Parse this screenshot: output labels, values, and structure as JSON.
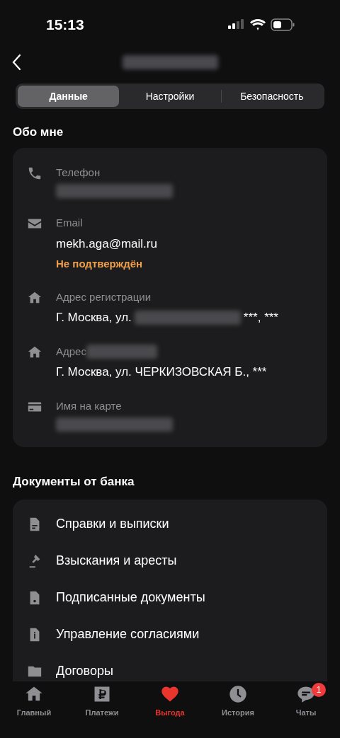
{
  "status_bar": {
    "time": "15:13"
  },
  "header": {
    "title_blurred": true
  },
  "tabs": [
    {
      "label": "Данные",
      "selected": true
    },
    {
      "label": "Настройки",
      "selected": false
    },
    {
      "label": "Безопасность",
      "selected": false
    }
  ],
  "about": {
    "title": "Обо мне",
    "items": [
      {
        "label": "Телефон",
        "value_blurred": true
      },
      {
        "label": "Email",
        "value": "mekh.aga@mail.ru",
        "note": "Не подтверждён"
      },
      {
        "label": "Адрес регистрации",
        "value": "Г. Москва, ул.",
        "value_blurred": true,
        "value_end": "***, ***"
      },
      {
        "label": "Адрес",
        "label_blurred": true,
        "value": "Г. Москва, ул. ЧЕРКИЗОВСКАЯ Б., ***"
      },
      {
        "label": "Имя на карте",
        "value_blurred": true
      }
    ]
  },
  "documents": {
    "title": "Документы от банка",
    "items": [
      {
        "label": "Справки и выписки"
      },
      {
        "label": "Взыскания и аресты"
      },
      {
        "label": "Подписанные документы"
      },
      {
        "label": "Управление согласиями"
      },
      {
        "label": "Договоры"
      }
    ]
  },
  "nav": [
    {
      "label": "Главный",
      "selected": false
    },
    {
      "label": "Платежи",
      "selected": false
    },
    {
      "label": "Выгода",
      "selected": true
    },
    {
      "label": "История",
      "selected": false
    },
    {
      "label": "Чаты",
      "selected": false,
      "badge": "1"
    }
  ]
}
